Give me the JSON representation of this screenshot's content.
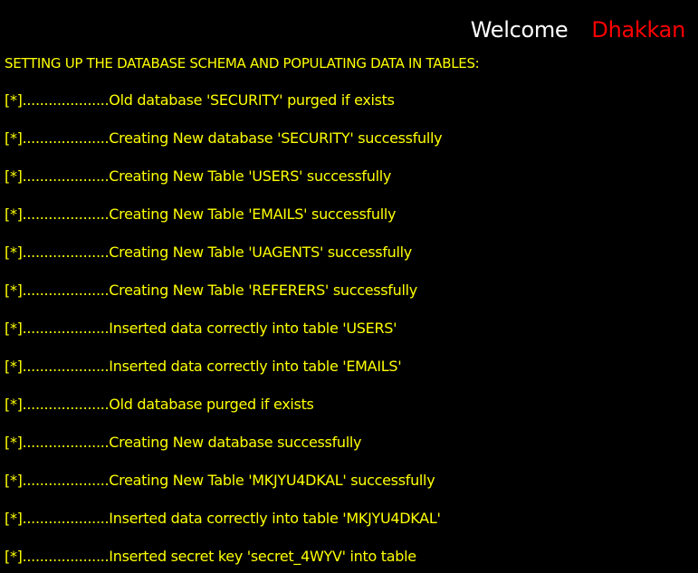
{
  "header": {
    "welcome_text": "Welcome",
    "user_name": "Dhakkan"
  },
  "heading": "SETTING UP THE DATABASE SCHEMA AND POPULATING DATA IN TABLES:",
  "log_lines": [
    "[*]....................Old database 'SECURITY' purged if exists",
    "[*]....................Creating New database 'SECURITY' successfully",
    "[*]....................Creating New Table 'USERS' successfully",
    "[*]....................Creating New Table 'EMAILS' successfully",
    "[*]....................Creating New Table 'UAGENTS' successfully",
    "[*]....................Creating New Table 'REFERERS' successfully",
    "[*]....................Inserted data correctly into table 'USERS'",
    "[*]....................Inserted data correctly into table 'EMAILS'",
    "[*]....................Old database purged if exists",
    "[*]....................Creating New database successfully",
    "[*]....................Creating New Table 'MKJYU4DKAL' successfully",
    "[*]....................Inserted data correctly into table 'MKJYU4DKAL'",
    "[*]....................Inserted secret key 'secret_4WYV' into table"
  ],
  "colors": {
    "background": "#000000",
    "log_text": "#ffff00",
    "welcome_text": "#ffffff",
    "user_name": "#ff0000"
  }
}
